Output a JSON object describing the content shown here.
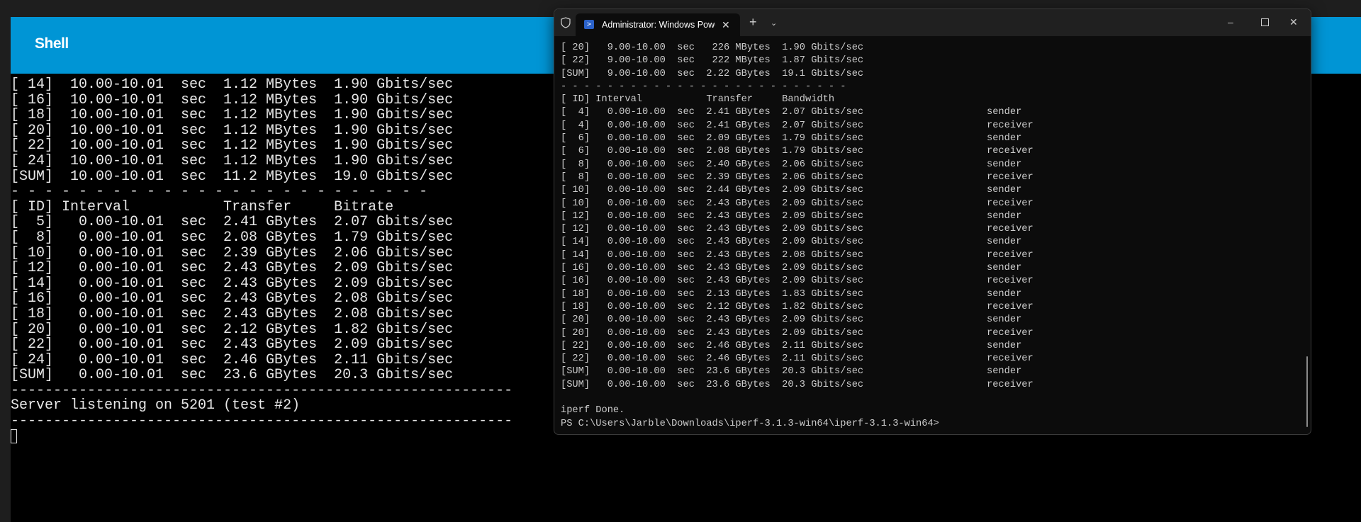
{
  "shell": {
    "title": "Shell",
    "lines": [
      "[ 14]  10.00-10.01  sec  1.12 MBytes  1.90 Gbits/sec",
      "[ 16]  10.00-10.01  sec  1.12 MBytes  1.90 Gbits/sec",
      "[ 18]  10.00-10.01  sec  1.12 MBytes  1.90 Gbits/sec",
      "[ 20]  10.00-10.01  sec  1.12 MBytes  1.90 Gbits/sec",
      "[ 22]  10.00-10.01  sec  1.12 MBytes  1.90 Gbits/sec",
      "[ 24]  10.00-10.01  sec  1.12 MBytes  1.90 Gbits/sec",
      "[SUM]  10.00-10.01  sec  11.2 MBytes  19.0 Gbits/sec",
      "- - - - - - - - - - - - - - - - - - - - - - - - -",
      "[ ID] Interval           Transfer     Bitrate",
      "[  5]   0.00-10.01  sec  2.41 GBytes  2.07 Gbits/sec",
      "[  8]   0.00-10.01  sec  2.08 GBytes  1.79 Gbits/sec",
      "[ 10]   0.00-10.01  sec  2.39 GBytes  2.06 Gbits/sec",
      "[ 12]   0.00-10.01  sec  2.43 GBytes  2.09 Gbits/sec",
      "[ 14]   0.00-10.01  sec  2.43 GBytes  2.09 Gbits/sec",
      "[ 16]   0.00-10.01  sec  2.43 GBytes  2.08 Gbits/sec",
      "[ 18]   0.00-10.01  sec  2.43 GBytes  2.08 Gbits/sec",
      "[ 20]   0.00-10.01  sec  2.12 GBytes  1.82 Gbits/sec",
      "[ 22]   0.00-10.01  sec  2.43 GBytes  2.09 Gbits/sec",
      "[ 24]   0.00-10.01  sec  2.46 GBytes  2.11 Gbits/sec",
      "[SUM]   0.00-10.01  sec  23.6 GBytes  20.3 Gbits/sec",
      "-----------------------------------------------------------",
      "Server listening on 5201 (test #2)",
      "-----------------------------------------------------------"
    ]
  },
  "terminal": {
    "tab_title": "Administrator: Windows PowerShell",
    "icons": {
      "shield": "shield-icon",
      "powershell": "powershell-icon",
      "close_tab": "close-icon",
      "new_tab": "plus-icon",
      "dropdown": "chevron-down-icon",
      "minimize": "minimize-icon",
      "maximize": "maximize-icon",
      "close": "close-icon"
    },
    "lines": [
      {
        "text": "[ 20]   9.00-10.00  sec   226 MBytes  1.90 Gbits/sec",
        "role": ""
      },
      {
        "text": "[ 22]   9.00-10.00  sec   222 MBytes  1.87 Gbits/sec",
        "role": ""
      },
      {
        "text": "[SUM]   9.00-10.00  sec  2.22 GBytes  19.1 Gbits/sec",
        "role": ""
      },
      {
        "text": "- - - - - - - - - - - - - - - - - - - - - - - - -",
        "role": ""
      },
      {
        "text": "[ ID] Interval           Transfer     Bandwidth",
        "role": ""
      },
      {
        "text": "[  4]   0.00-10.00  sec  2.41 GBytes  2.07 Gbits/sec",
        "role": "sender"
      },
      {
        "text": "[  4]   0.00-10.00  sec  2.41 GBytes  2.07 Gbits/sec",
        "role": "receiver"
      },
      {
        "text": "[  6]   0.00-10.00  sec  2.09 GBytes  1.79 Gbits/sec",
        "role": "sender"
      },
      {
        "text": "[  6]   0.00-10.00  sec  2.08 GBytes  1.79 Gbits/sec",
        "role": "receiver"
      },
      {
        "text": "[  8]   0.00-10.00  sec  2.40 GBytes  2.06 Gbits/sec",
        "role": "sender"
      },
      {
        "text": "[  8]   0.00-10.00  sec  2.39 GBytes  2.06 Gbits/sec",
        "role": "receiver"
      },
      {
        "text": "[ 10]   0.00-10.00  sec  2.44 GBytes  2.09 Gbits/sec",
        "role": "sender"
      },
      {
        "text": "[ 10]   0.00-10.00  sec  2.43 GBytes  2.09 Gbits/sec",
        "role": "receiver"
      },
      {
        "text": "[ 12]   0.00-10.00  sec  2.43 GBytes  2.09 Gbits/sec",
        "role": "sender"
      },
      {
        "text": "[ 12]   0.00-10.00  sec  2.43 GBytes  2.09 Gbits/sec",
        "role": "receiver"
      },
      {
        "text": "[ 14]   0.00-10.00  sec  2.43 GBytes  2.09 Gbits/sec",
        "role": "sender"
      },
      {
        "text": "[ 14]   0.00-10.00  sec  2.43 GBytes  2.08 Gbits/sec",
        "role": "receiver"
      },
      {
        "text": "[ 16]   0.00-10.00  sec  2.43 GBytes  2.09 Gbits/sec",
        "role": "sender"
      },
      {
        "text": "[ 16]   0.00-10.00  sec  2.43 GBytes  2.09 Gbits/sec",
        "role": "receiver"
      },
      {
        "text": "[ 18]   0.00-10.00  sec  2.13 GBytes  1.83 Gbits/sec",
        "role": "sender"
      },
      {
        "text": "[ 18]   0.00-10.00  sec  2.12 GBytes  1.82 Gbits/sec",
        "role": "receiver"
      },
      {
        "text": "[ 20]   0.00-10.00  sec  2.43 GBytes  2.09 Gbits/sec",
        "role": "sender"
      },
      {
        "text": "[ 20]   0.00-10.00  sec  2.43 GBytes  2.09 Gbits/sec",
        "role": "receiver"
      },
      {
        "text": "[ 22]   0.00-10.00  sec  2.46 GBytes  2.11 Gbits/sec",
        "role": "sender"
      },
      {
        "text": "[ 22]   0.00-10.00  sec  2.46 GBytes  2.11 Gbits/sec",
        "role": "receiver"
      },
      {
        "text": "[SUM]   0.00-10.00  sec  23.6 GBytes  20.3 Gbits/sec",
        "role": "sender"
      },
      {
        "text": "[SUM]   0.00-10.00  sec  23.6 GBytes  20.3 Gbits/sec",
        "role": "receiver"
      },
      {
        "text": "",
        "role": ""
      },
      {
        "text": "iperf Done.",
        "role": ""
      },
      {
        "text": "PS C:\\Users\\Jarble\\Downloads\\iperf-3.1.3-win64\\iperf-3.1.3-win64>",
        "role": ""
      }
    ]
  },
  "colors": {
    "header": "#0095d5",
    "terminal_bg": "#0c0c0c",
    "shell_bg": "#000000"
  }
}
